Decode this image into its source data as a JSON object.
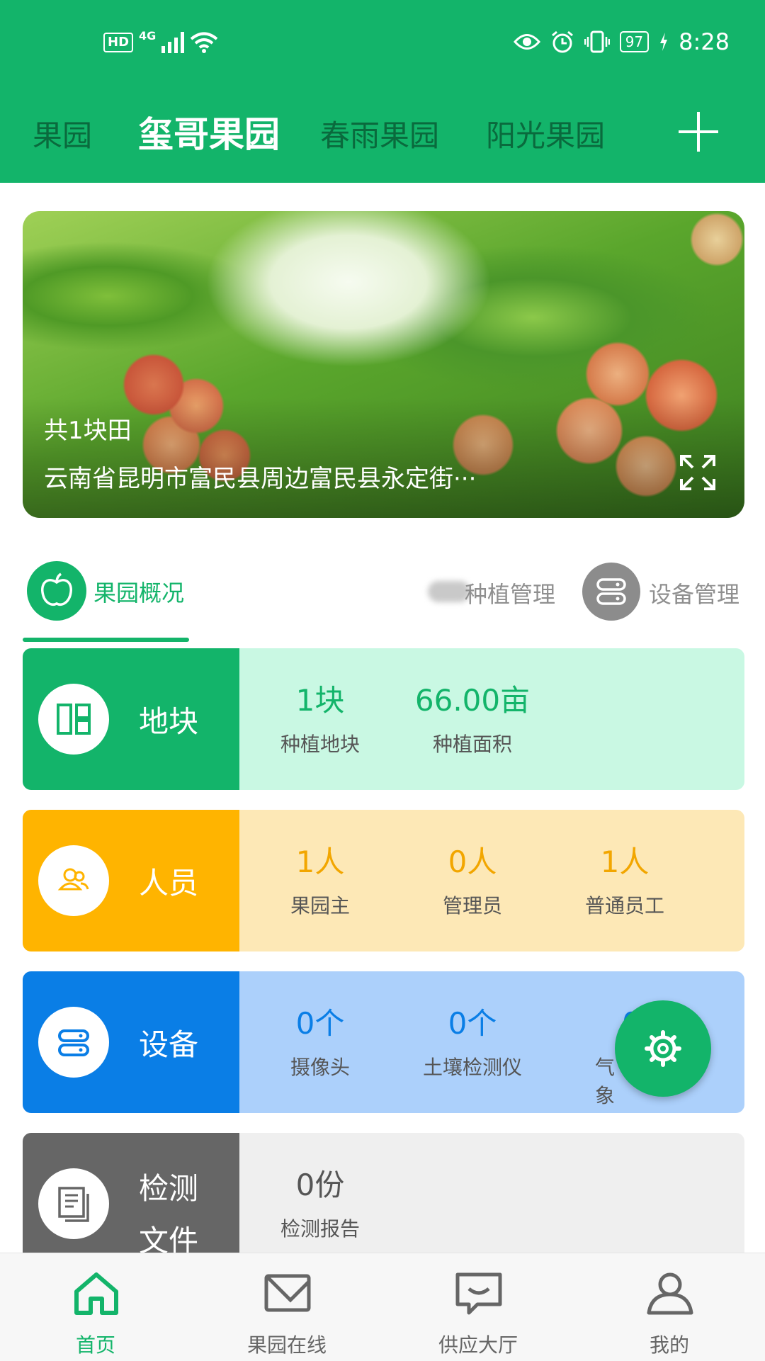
{
  "status_bar": {
    "hd": "HD",
    "network": "4G",
    "battery": "97",
    "time": "8:28"
  },
  "header": {
    "tabs": [
      "果园",
      "玺哥果园",
      "春雨果园",
      "阳光果园"
    ],
    "active_index": 1,
    "add_icon": "plus-icon"
  },
  "banner": {
    "field_count": "共1块田",
    "address": "云南省昆明市富民县周边富民县永定街···",
    "expand_icon": "expand-icon"
  },
  "section_tabs": [
    {
      "label": "果园概况",
      "icon": "apple-icon",
      "active": true
    },
    {
      "label": "种植管理",
      "icon": "leaf-icon",
      "active": false
    },
    {
      "label": "设备管理",
      "icon": "server-icon",
      "active": false
    }
  ],
  "cards": {
    "plots": {
      "title": "地块",
      "icon": "plot-icon",
      "stats": [
        {
          "value": "1块",
          "label": "种植地块"
        },
        {
          "value": "66.00亩",
          "label": "种植面积"
        }
      ]
    },
    "staff": {
      "title": "人员",
      "icon": "people-icon",
      "stats": [
        {
          "value": "1人",
          "label": "果园主"
        },
        {
          "value": "0人",
          "label": "管理员"
        },
        {
          "value": "1人",
          "label": "普通员工"
        }
      ]
    },
    "devices": {
      "title": "设备",
      "icon": "device-icon",
      "stats": [
        {
          "value": "0个",
          "label": "摄像头"
        },
        {
          "value": "0个",
          "label": "土壤检测仪"
        },
        {
          "value": "0",
          "label": "气象"
        }
      ]
    },
    "reports": {
      "title_line1": "检测",
      "title_line2": "文件",
      "icon": "document-icon",
      "stats": [
        {
          "value": "0份",
          "label": "检测报告"
        }
      ]
    }
  },
  "fab": {
    "icon": "settings-icon"
  },
  "bottom_nav": [
    {
      "label": "首页",
      "icon": "home-icon",
      "active": true
    },
    {
      "label": "果园在线",
      "icon": "orchard-online-icon",
      "active": false
    },
    {
      "label": "供应大厅",
      "icon": "supply-hall-icon",
      "active": false
    },
    {
      "label": "我的",
      "icon": "profile-icon",
      "active": false
    }
  ],
  "colors": {
    "primary": "#13b46a",
    "staff": "#ffb400",
    "devices": "#0a7ee6",
    "reports": "#666666"
  }
}
